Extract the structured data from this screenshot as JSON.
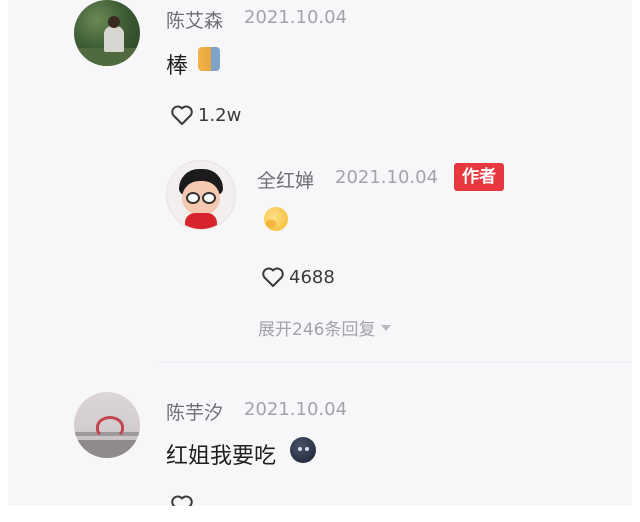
{
  "comments": [
    {
      "username": "陈艾森",
      "date": "2021.10.04",
      "content": "棒",
      "emoji": "cat-face-emoji",
      "likes": "1.2w"
    },
    {
      "username": "全红婵",
      "date": "2021.10.04",
      "badge": "作者",
      "emoji": "thinking-face-emoji",
      "likes": "4688",
      "expand_replies": "展开246条回复"
    },
    {
      "username": "陈芋汐",
      "date": "2021.10.04",
      "content": "红姐我要吃",
      "emoji": "dark-blob-emoji"
    }
  ],
  "colors": {
    "background": "#f7f7f9",
    "badge": "#e8383f",
    "username": "#6f6f74",
    "date": "#a3a3a8"
  },
  "icons": {
    "like": "heart-outline-icon",
    "expand": "caret-down-icon"
  }
}
